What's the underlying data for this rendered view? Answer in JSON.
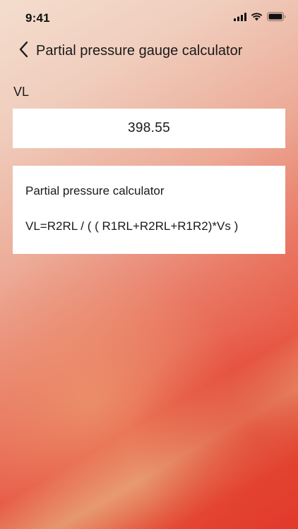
{
  "status_bar": {
    "time": "9:41",
    "icons": [
      "cellular-signal-icon",
      "wifi-icon",
      "battery-icon"
    ]
  },
  "nav": {
    "back_icon": "chevron-left-icon",
    "title": "Partial pressure gauge calculator"
  },
  "result": {
    "label": "VL",
    "value": "398.55"
  },
  "info": {
    "title": "Partial pressure calculator",
    "formula": "VL=R2RL / ( ( R1RL+R2RL+R1R2)*Vs )"
  },
  "colors": {
    "background_top": "#F4DDCD",
    "background_bottom": "#E2382C",
    "card": "#FFFFFF",
    "text": "#1A1A1A"
  }
}
